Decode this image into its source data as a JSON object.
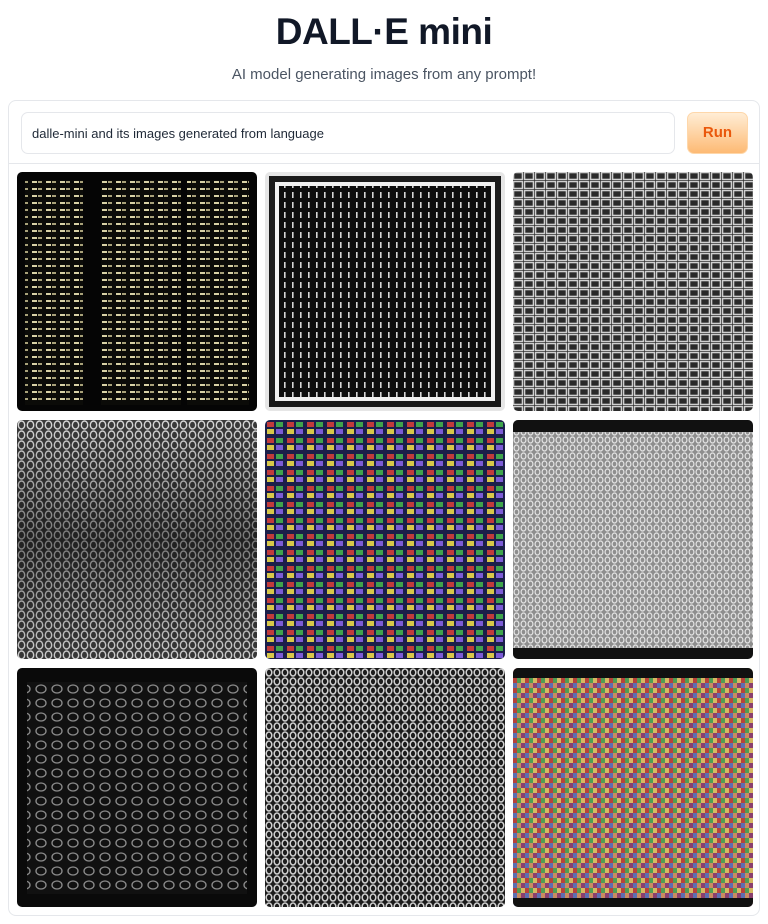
{
  "header": {
    "title": "DALL·E mini",
    "subtitle": "AI model generating images from any prompt!"
  },
  "prompt": {
    "value": "dalle-mini and its images generated from language"
  },
  "run_button": {
    "label": "Run"
  },
  "colors": {
    "accent": "#ea580c",
    "button_bg": "#fed7aa",
    "border": "#e5e7eb"
  },
  "gallery": {
    "images": [
      {
        "name": "generated-image-1",
        "style": "columns-text"
      },
      {
        "name": "generated-image-2",
        "style": "framed-stripes"
      },
      {
        "name": "generated-image-3",
        "style": "grey-mesh"
      },
      {
        "name": "generated-image-4",
        "style": "grey-knit"
      },
      {
        "name": "generated-image-5",
        "style": "color-grid"
      },
      {
        "name": "generated-image-6",
        "style": "grey-texture"
      },
      {
        "name": "generated-image-7",
        "style": "dark-script"
      },
      {
        "name": "generated-image-8",
        "style": "chain-texture"
      },
      {
        "name": "generated-image-9",
        "style": "colorful-noise"
      }
    ]
  }
}
